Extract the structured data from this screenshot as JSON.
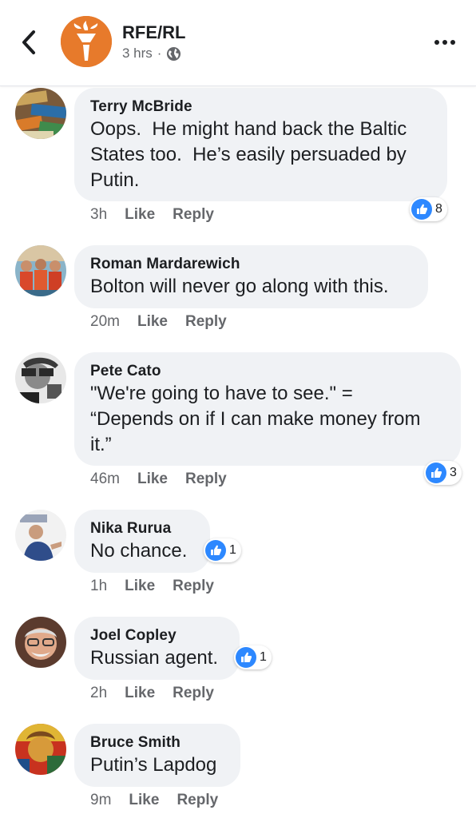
{
  "header": {
    "page_name": "RFE/RL",
    "time": "3 hrs",
    "separator": "·"
  },
  "colors": {
    "brand": "#e77a2b",
    "like": "#2d88ff",
    "bubble": "#f0f2f5"
  },
  "comments": [
    {
      "author": "Terry McBride",
      "text": "Oops.  He might hand back the Baltic\nStates too.  He’s easily persuaded by\nPutin.",
      "time": "3h",
      "like": "Like",
      "reply": "Reply",
      "reactions": "8"
    },
    {
      "author": "Roman Mardarewich",
      "text": "Bolton will never go along with this.",
      "time": "20m",
      "like": "Like",
      "reply": "Reply",
      "reactions": ""
    },
    {
      "author": "Pete Cato",
      "text": "\"We're going to have to see.\" =\n“Depends on if I can make money from\nit.”",
      "time": "46m",
      "like": "Like",
      "reply": "Reply",
      "reactions": "3"
    },
    {
      "author": "Nika Rurua",
      "text": "No chance.",
      "time": "1h",
      "like": "Like",
      "reply": "Reply",
      "reactions": "1"
    },
    {
      "author": "Joel Copley",
      "text": "Russian agent.",
      "time": "2h",
      "like": "Like",
      "reply": "Reply",
      "reactions": "1"
    },
    {
      "author": "Bruce Smith",
      "text": "Putin’s Lapdog",
      "time": "9m",
      "like": "Like",
      "reply": "Reply",
      "reactions": ""
    }
  ]
}
